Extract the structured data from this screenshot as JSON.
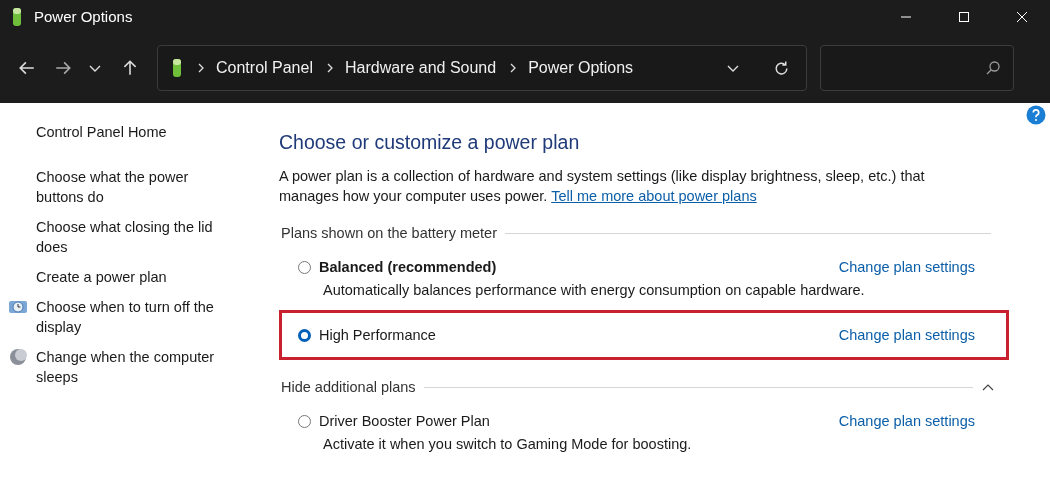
{
  "window": {
    "title": "Power Options"
  },
  "address": {
    "crumbs": [
      "Control Panel",
      "Hardware and Sound",
      "Power Options"
    ]
  },
  "sidebar": {
    "items": [
      {
        "label": "Control Panel Home",
        "kind": "home"
      },
      {
        "label": "Choose what the power buttons do",
        "kind": "link"
      },
      {
        "label": "Choose what closing the lid does",
        "kind": "link"
      },
      {
        "label": "Create a power plan",
        "kind": "link"
      },
      {
        "label": "Choose when to turn off the display",
        "kind": "display"
      },
      {
        "label": "Change when the computer sleeps",
        "kind": "sleep"
      }
    ]
  },
  "main": {
    "heading": "Choose or customize a power plan",
    "description": "A power plan is a collection of hardware and system settings (like display brightness, sleep, etc.) that manages how your computer uses power.",
    "link": "Tell me more about power plans",
    "sections": [
      {
        "title": "Plans shown on the battery meter",
        "collapsible": false,
        "expanded": true,
        "plans": [
          {
            "name": "Balanced (recommended)",
            "bold": true,
            "selected": false,
            "highlighted": false,
            "description": "Automatically balances performance with energy consumption on capable hardware.",
            "action": "Change plan settings"
          },
          {
            "name": "High Performance",
            "bold": false,
            "selected": true,
            "highlighted": true,
            "action": "Change plan settings"
          }
        ]
      },
      {
        "title": "Hide additional plans",
        "collapsible": true,
        "expanded": true,
        "plans": [
          {
            "name": "Driver Booster Power Plan",
            "bold": false,
            "selected": false,
            "highlighted": false,
            "description": "Activate it when you switch to Gaming Mode for boosting.",
            "action": "Change plan settings"
          }
        ]
      }
    ]
  }
}
